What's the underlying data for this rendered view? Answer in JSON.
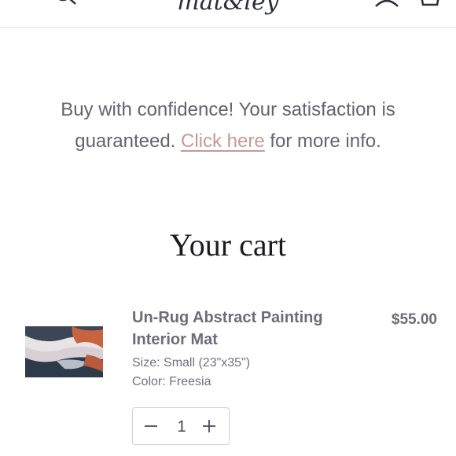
{
  "header": {
    "logo_text": "mat&ley",
    "icons": [
      "menu-icon",
      "search-icon",
      "account-icon",
      "cart-icon"
    ]
  },
  "notice": {
    "text_before": "Buy with confidence! Your satisfaction is guaranteed. ",
    "link_text": "Click here",
    "text_after": " for more info.",
    "link_color": "#c49a97"
  },
  "cart": {
    "title": "Your cart",
    "items": [
      {
        "name": "Un-Rug Abstract Painting Interior Mat",
        "size": "Size: Small (23\"x35\")",
        "color": "Color: Freesia",
        "price": "$55.00",
        "quantity": "1"
      }
    ]
  }
}
